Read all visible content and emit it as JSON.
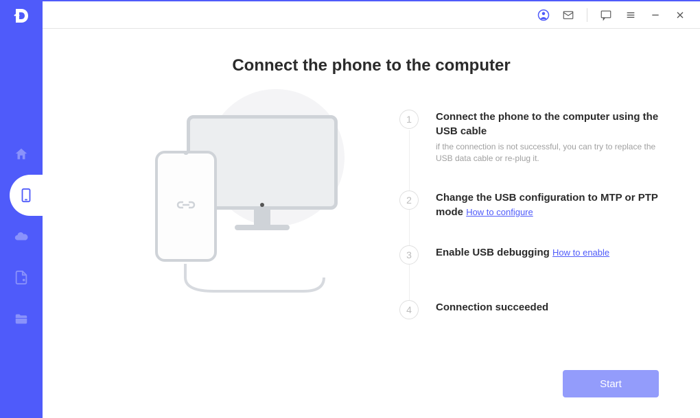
{
  "sidebar": {
    "logo_letter": "D",
    "items": [
      {
        "name": "home-icon"
      },
      {
        "name": "phone-icon",
        "active": true
      },
      {
        "name": "cloud-icon"
      },
      {
        "name": "document-icon"
      },
      {
        "name": "folder-icon"
      }
    ]
  },
  "topbar": {
    "icons": [
      "user-icon",
      "mail-icon",
      "chat-icon",
      "menu-icon",
      "minimize-icon",
      "close-icon"
    ]
  },
  "page": {
    "title": "Connect the phone to the computer"
  },
  "steps": [
    {
      "num": "1",
      "title": "Connect the phone to the computer using the USB cable",
      "desc": "if the connection is not successful, you can try to replace the USB data cable or re-plug it.",
      "link": null
    },
    {
      "num": "2",
      "title": "Change the USB configuration to MTP or PTP mode",
      "desc": null,
      "link": "How to configure"
    },
    {
      "num": "3",
      "title": "Enable USB debugging",
      "desc": null,
      "link": "How to enable"
    },
    {
      "num": "4",
      "title": "Connection succeeded",
      "desc": null,
      "link": null
    }
  ],
  "footer": {
    "start_label": "Start"
  }
}
